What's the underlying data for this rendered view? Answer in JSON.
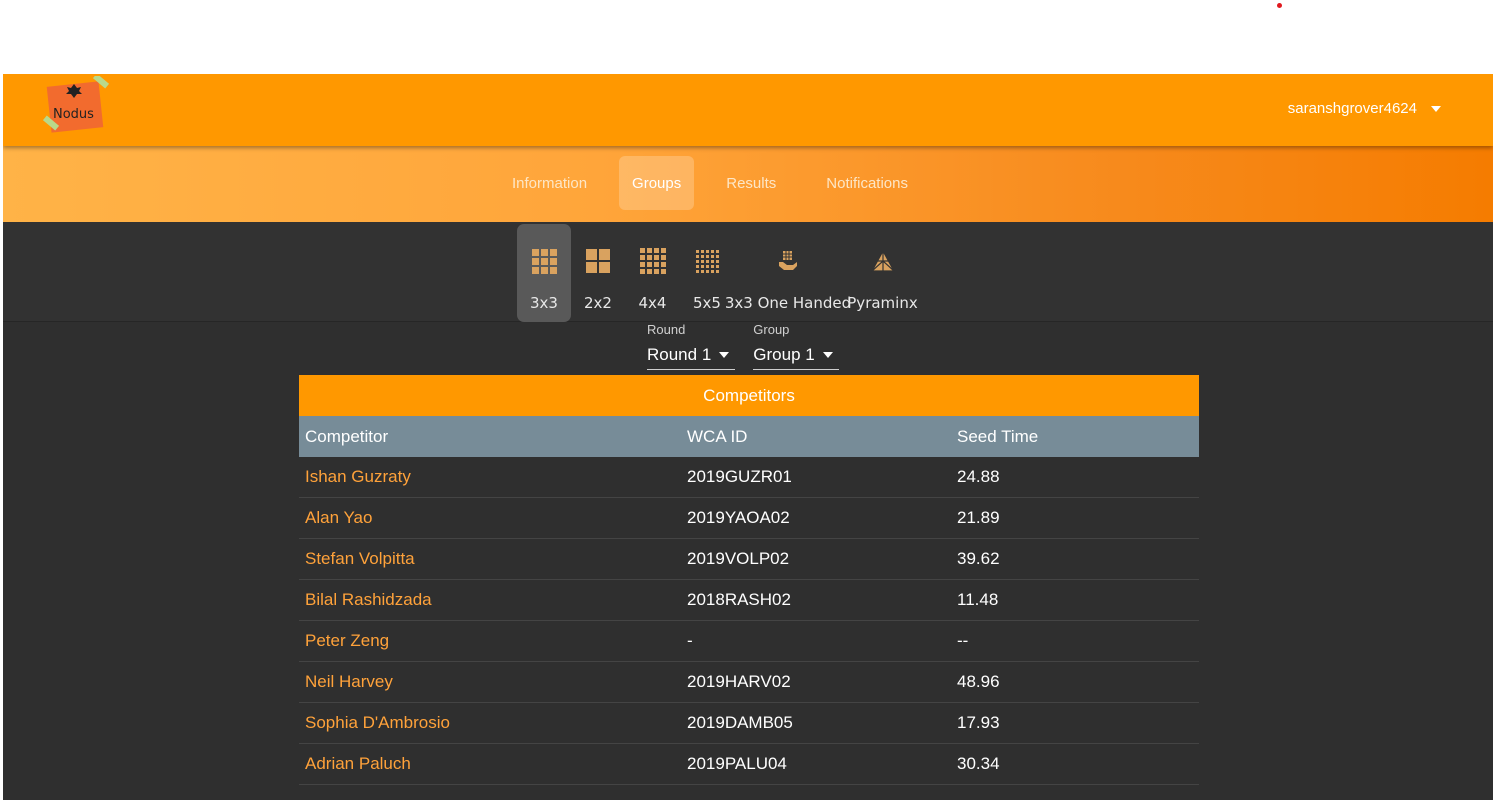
{
  "header": {
    "logo_text": "Nodus",
    "username": "saranshgrover4624"
  },
  "tabs": [
    {
      "label": "Information",
      "active": false
    },
    {
      "label": "Groups",
      "active": true
    },
    {
      "label": "Results",
      "active": false
    },
    {
      "label": "Notifications",
      "active": false
    }
  ],
  "events": [
    {
      "label": "3x3",
      "icon": "cube-3x3-icon",
      "active": true
    },
    {
      "label": "2x2",
      "icon": "cube-2x2-icon",
      "active": false
    },
    {
      "label": "4x4",
      "icon": "cube-4x4-icon",
      "active": false
    },
    {
      "label": "5x5",
      "icon": "cube-5x5-icon",
      "active": false
    },
    {
      "label": "3x3 One Handed",
      "icon": "one-handed-icon",
      "active": false
    },
    {
      "label": "Pyraminx",
      "icon": "pyraminx-icon",
      "active": false
    }
  ],
  "selects": {
    "round_label": "Round",
    "round_value": "Round 1",
    "group_label": "Group",
    "group_value": "Group 1"
  },
  "table": {
    "title": "Competitors",
    "headers": [
      "Competitor",
      "WCA ID",
      "Seed Time"
    ],
    "rows": [
      [
        "Ishan Guzraty",
        "2019GUZR01",
        "24.88"
      ],
      [
        "Alan Yao",
        "2019YAOA02",
        "21.89"
      ],
      [
        "Stefan Volpitta",
        "2019VOLP02",
        "39.62"
      ],
      [
        "Bilal Rashidzada",
        "2018RASH02",
        "11.48"
      ],
      [
        "Peter Zeng",
        "-",
        "--"
      ],
      [
        "Neil Harvey",
        "2019HARV02",
        "48.96"
      ],
      [
        "Sophia D'Ambrosio",
        "2019DAMB05",
        "17.93"
      ],
      [
        "Adrian Paluch",
        "2019PALU04",
        "30.34"
      ]
    ]
  },
  "colors": {
    "accent": "#ff9800",
    "table_header": "#778c98",
    "link": "#ffa23a",
    "background": "#2f2f2f"
  }
}
